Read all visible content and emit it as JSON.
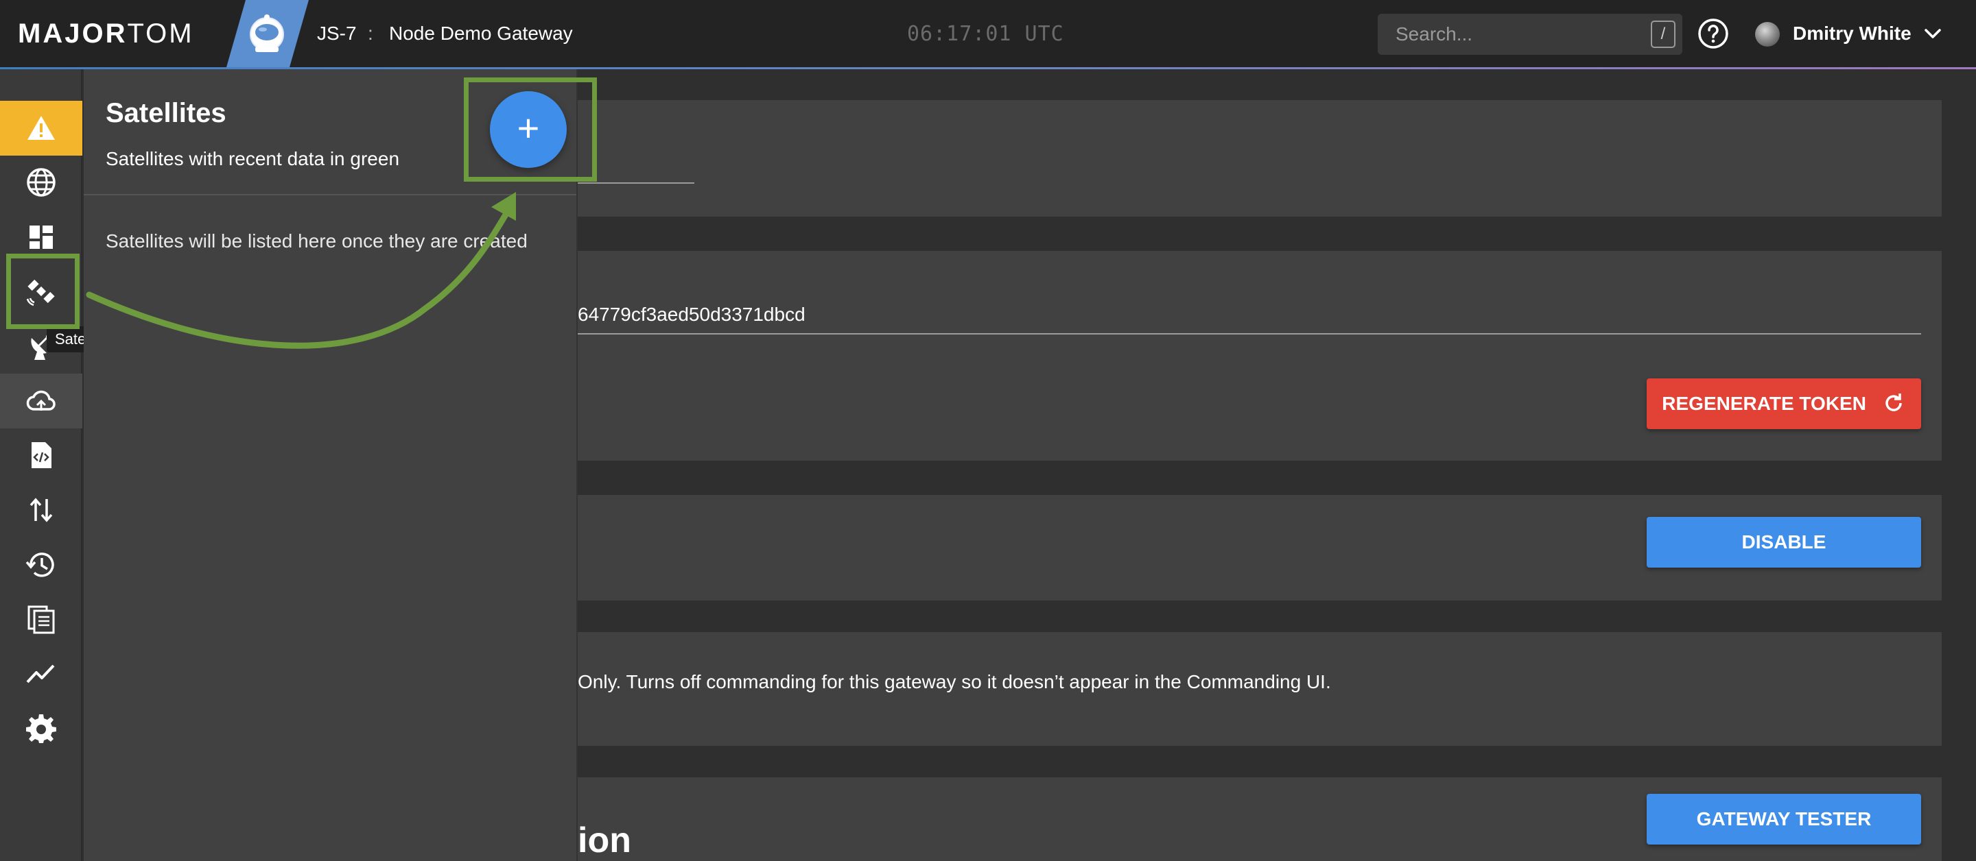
{
  "header": {
    "logo_major": "MAJOR",
    "logo_tom": "TOM",
    "gateway_id": "JS-7",
    "gateway_separator": ":",
    "gateway_name": "Node Demo Gateway",
    "clock": "06:17:01 UTC",
    "search_placeholder": "Search...",
    "search_shortcut": "/",
    "help_icon": "help-circle-icon",
    "user_name": "Dmitry White",
    "accent_color": "#5b8fcf"
  },
  "nav": {
    "items": [
      {
        "icon": "alert-icon",
        "name": "alerts"
      },
      {
        "icon": "globe-icon",
        "name": "globe"
      },
      {
        "icon": "dashboard-icon",
        "name": "dashboard"
      },
      {
        "icon": "satellite-icon",
        "name": "satellites"
      },
      {
        "icon": "ground-station-icon",
        "name": "ground-stations"
      },
      {
        "icon": "cloud-sync-icon",
        "name": "gateways"
      },
      {
        "icon": "code-file-icon",
        "name": "scripts"
      },
      {
        "icon": "transfer-icon",
        "name": "file-transfer"
      },
      {
        "icon": "history-icon",
        "name": "history"
      },
      {
        "icon": "documents-icon",
        "name": "documents"
      },
      {
        "icon": "chart-line-icon",
        "name": "metrics"
      },
      {
        "icon": "gear-icon",
        "name": "settings"
      }
    ],
    "tooltip": "Satellites",
    "alert_color": "#f2b52b"
  },
  "satellites_panel": {
    "title": "Satellites",
    "subtitle": "Satellites with recent data in green",
    "empty_message": "Satellites will be listed here once they are created",
    "add_button": "+"
  },
  "main": {
    "token_value": "64779cf3aed50d3371dbcd",
    "regenerate_label": "REGENERATE TOKEN",
    "disable_label": "DISABLE",
    "readonly_description": "Only. Turns off commanding for this gateway so it doesn’t appear in the Commanding UI.",
    "tester_label": "GATEWAY TESTER",
    "section_heading_fragment": "ion",
    "danger_color": "#e14235",
    "primary_color": "#3f8ee9"
  },
  "annotation": {
    "color": "#6f9b3f"
  }
}
